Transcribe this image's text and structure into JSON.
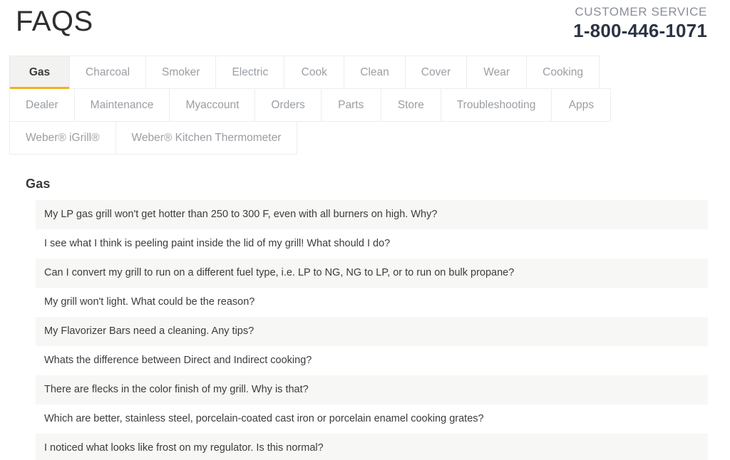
{
  "header": {
    "title": "FAQS",
    "customer_service_label": "CUSTOMER SERVICE",
    "phone": "1-800-446-1071"
  },
  "theme": {
    "accent": "#efb222",
    "title_color": "#2f2f2f",
    "phone_color": "#2b3444",
    "tab_inactive_color": "#9a9ea3",
    "row_shade": "#f7f7f6"
  },
  "tabs": {
    "active": "Gas",
    "rows": [
      [
        {
          "label": "Gas",
          "active": true
        },
        {
          "label": "Charcoal",
          "active": false
        },
        {
          "label": "Smoker",
          "active": false
        },
        {
          "label": "Electric",
          "active": false
        },
        {
          "label": "Cook",
          "active": false
        },
        {
          "label": "Clean",
          "active": false
        },
        {
          "label": "Cover",
          "active": false
        },
        {
          "label": "Wear",
          "active": false
        },
        {
          "label": "Cooking",
          "active": false
        }
      ],
      [
        {
          "label": "Dealer",
          "active": false
        },
        {
          "label": "Maintenance",
          "active": false
        },
        {
          "label": "Myaccount",
          "active": false
        },
        {
          "label": "Orders",
          "active": false
        },
        {
          "label": "Parts",
          "active": false
        },
        {
          "label": "Store",
          "active": false
        },
        {
          "label": "Troubleshooting",
          "active": false
        },
        {
          "label": "Apps",
          "active": false
        }
      ],
      [
        {
          "label": "Weber® iGrill®",
          "active": false
        },
        {
          "label": "Weber® Kitchen Thermometer",
          "active": false
        }
      ]
    ]
  },
  "content": {
    "section_title": "Gas",
    "faqs": [
      "My LP gas grill won't get hotter than 250 to 300 F, even with all burners on high. Why?",
      "I see what I think is peeling paint inside the lid of my grill! What should I do?",
      "Can I convert my grill to run on a different fuel type, i.e. LP to NG, NG to LP, or to run on bulk propane?",
      "My grill won't light. What could be the reason?",
      "My Flavorizer Bars need a cleaning. Any tips?",
      "Whats the difference between Direct and Indirect cooking?",
      "There are flecks in the color finish of my grill. Why is that?",
      "Which are better, stainless steel, porcelain-coated cast iron or porcelain enamel cooking grates?",
      "I noticed what looks like frost on my regulator. Is this normal?"
    ]
  }
}
